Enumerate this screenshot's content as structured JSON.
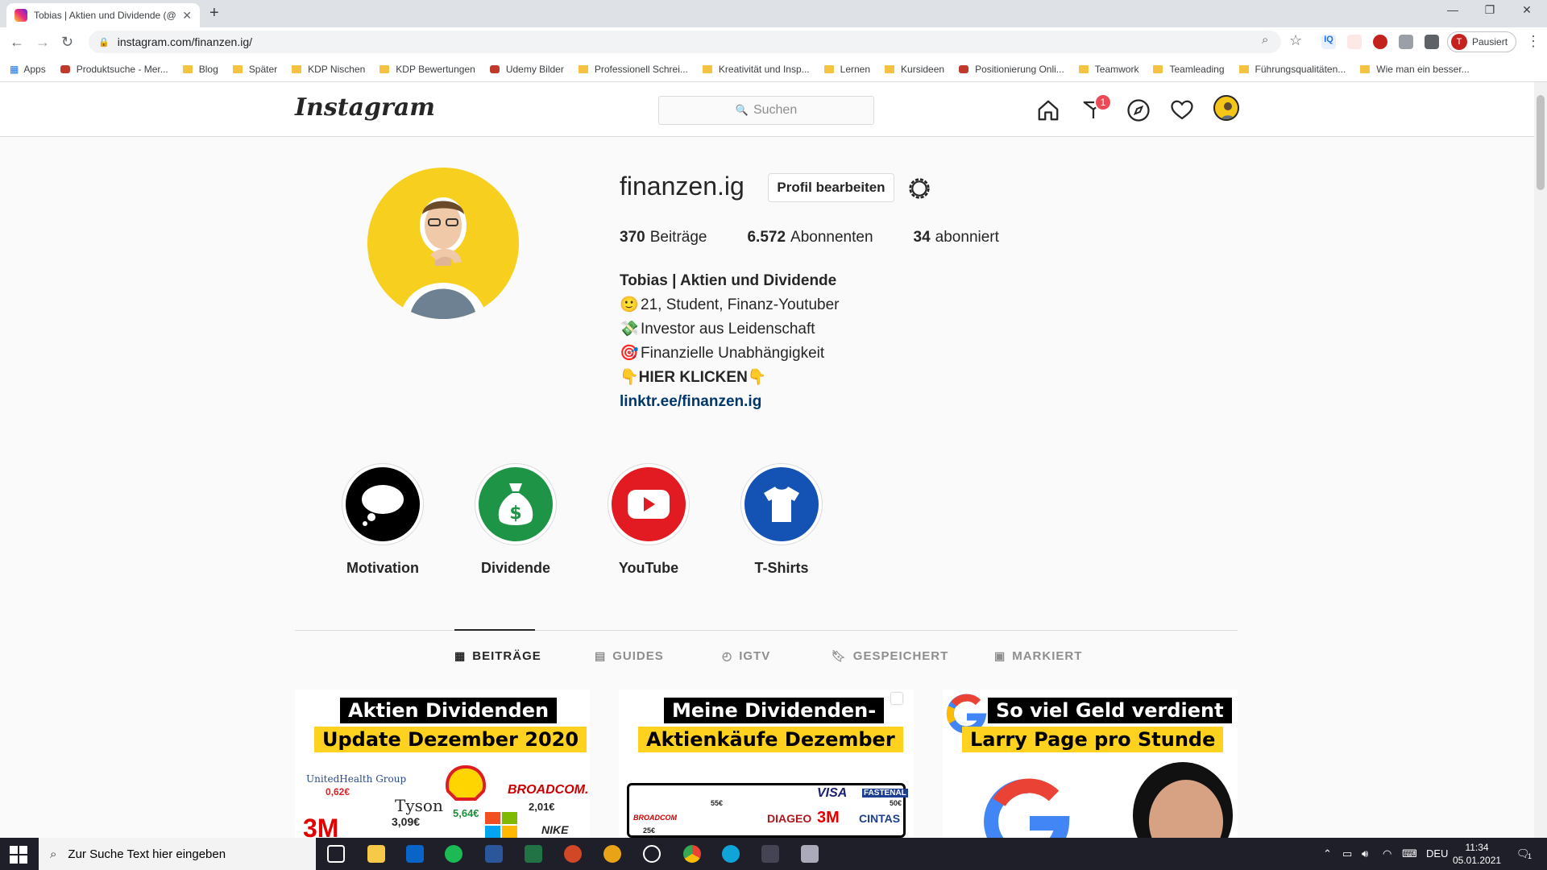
{
  "browser": {
    "tab_title": "Tobias | Aktien und Dividende (@",
    "new_tab": "+",
    "url": "instagram.com/finanzen.ig/",
    "profile_status": "Pausiert",
    "profile_initial": "T",
    "bookmarks": [
      {
        "label": "Apps",
        "type": "apps"
      },
      {
        "label": "Produktsuche - Mer...",
        "type": "site"
      },
      {
        "label": "Blog",
        "type": "folder"
      },
      {
        "label": "Später",
        "type": "folder"
      },
      {
        "label": "KDP Nischen",
        "type": "folder"
      },
      {
        "label": "KDP Bewertungen",
        "type": "folder"
      },
      {
        "label": "Udemy Bilder",
        "type": "site"
      },
      {
        "label": "Professionell Schrei...",
        "type": "folder"
      },
      {
        "label": "Kreativität und Insp...",
        "type": "folder"
      },
      {
        "label": "Lernen",
        "type": "folder"
      },
      {
        "label": "Kursideen",
        "type": "folder"
      },
      {
        "label": "Positionierung Onli...",
        "type": "site"
      },
      {
        "label": "Teamwork",
        "type": "folder"
      },
      {
        "label": "Teamleading",
        "type": "folder"
      },
      {
        "label": "Führungsqualitäten...",
        "type": "folder"
      },
      {
        "label": "Wie man ein besser...",
        "type": "folder"
      }
    ]
  },
  "instagram": {
    "logo": "Instagram",
    "search_placeholder": "Suchen",
    "dm_badge": "1",
    "profile": {
      "username": "finanzen.ig",
      "edit_button": "Profil bearbeiten",
      "stats": [
        {
          "count": "370",
          "label": "Beiträge"
        },
        {
          "count": "6.572",
          "label": "Abonnenten"
        },
        {
          "count": "34",
          "label": "abonniert"
        }
      ],
      "name": "Tobias | Aktien und Dividende",
      "bio_lines": [
        {
          "emoji": "🙂",
          "text": "21, Student, Finanz-Youtuber"
        },
        {
          "emoji": "💸",
          "text": "Investor aus Leidenschaft"
        },
        {
          "emoji": "🎯",
          "text": "Finanzielle Unabhängigkeit"
        }
      ],
      "cta": "HIER KLICKEN",
      "cta_emoji": "👇",
      "link": "linktr.ee/finanzen.ig"
    },
    "highlights": [
      {
        "label": "Motivation",
        "icon": "thought-cloud-icon",
        "color": "#000000"
      },
      {
        "label": "Dividende",
        "icon": "money-bag-icon",
        "color": "#1e9447"
      },
      {
        "label": "YouTube",
        "icon": "youtube-icon",
        "color": "#e21b23"
      },
      {
        "label": "T-Shirts",
        "icon": "tshirt-icon",
        "color": "#1452b4"
      }
    ],
    "tabs": [
      {
        "label": "BEITRÄGE",
        "icon": "grid-icon",
        "active": true
      },
      {
        "label": "GUIDES",
        "icon": "guides-icon",
        "active": false
      },
      {
        "label": "IGTV",
        "icon": "igtv-icon",
        "active": false
      },
      {
        "label": "GESPEICHERT",
        "icon": "bookmark-icon",
        "active": false
      },
      {
        "label": "MARKIERT",
        "icon": "tagged-icon",
        "active": false
      }
    ],
    "posts": [
      {
        "line1": "Aktien Dividenden",
        "line2": "Update Dezember 2020",
        "texts": [
          "UnitedHealth Group",
          "0,62€",
          "Tyson",
          "3,09€",
          "5,64€",
          "BROADCOM.",
          "2,01€",
          "3M",
          "NIKE"
        ]
      },
      {
        "line1": "Meine Dividenden-",
        "line2": "Aktienkäufe Dezember",
        "texts": [
          "VISA",
          "FASTENAL",
          "DIAGEO",
          "3M",
          "CINTAS",
          "BROADCOM",
          "25€",
          "55€",
          "50€"
        ]
      },
      {
        "line1": "So viel Geld verdient",
        "line2": "Larry Page pro Stunde",
        "texts": []
      }
    ]
  },
  "taskbar": {
    "search_placeholder": "Zur Suche Text hier eingeben",
    "language": "DEU",
    "time": "11:34",
    "date": "05.01.2021",
    "notification_count": "1"
  },
  "colors": {
    "accent_badge": "#ed4956",
    "link": "#00376b",
    "avatar_bg": "#f7cf1f"
  }
}
